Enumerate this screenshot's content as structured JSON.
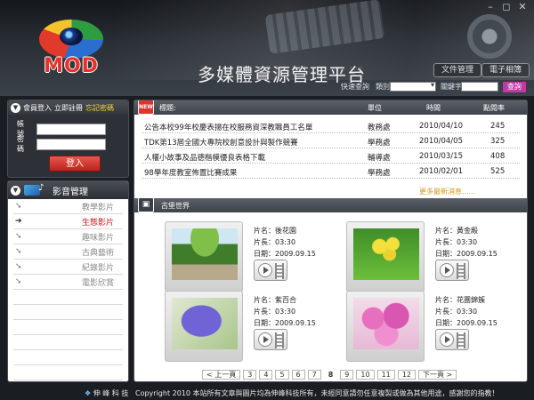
{
  "header": {
    "logo_text": "MOD",
    "title": "多媒體資源管理平台",
    "btn_file": "文件管理",
    "btn_album": "電子相簿",
    "window_controls": [
      "–",
      "◻",
      "✕"
    ]
  },
  "search": {
    "label": "快速查詢",
    "category_label": "類別",
    "category_value": "",
    "keyword_label": "關鍵字",
    "keyword_value": "",
    "button": "查詢"
  },
  "login": {
    "member_login": "會員登入",
    "register": "立即註冊",
    "forgot": "忘記密碼",
    "account_label": "帳　號",
    "password_label": "密　碼",
    "account_value": "",
    "password_value": "",
    "submit": "登入"
  },
  "menu": {
    "title": "影音管理",
    "items": [
      {
        "label": "教學影片"
      },
      {
        "label": "生態影片"
      },
      {
        "label": "趣味影片"
      },
      {
        "label": "古典藝術"
      },
      {
        "label": "紀錄影片"
      },
      {
        "label": "電影欣賞"
      }
    ]
  },
  "news": {
    "badge": "NEW",
    "columns": {
      "title": "標題:",
      "unit": "單位",
      "date": "時間",
      "clicks": "點閱率"
    },
    "rows": [
      {
        "title": "公告本校99年校慶表揚在校服務資深教職員工名單",
        "unit": "教務處",
        "date": "2010/04/10",
        "clicks": "245"
      },
      {
        "title": "TDK第13屆全國大專院校創意設計與製作競賽",
        "unit": "學務處",
        "date": "2010/04/05",
        "clicks": "325"
      },
      {
        "title": "人權小故事及品德楷模優良表格下載",
        "unit": "輔導處",
        "date": "2010/03/15",
        "clicks": "408"
      },
      {
        "title": "98學年度教室佈置比賽成果",
        "unit": "學務處",
        "date": "2010/02/01",
        "clicks": "525"
      }
    ],
    "more": "更多最新消息......"
  },
  "gallery": {
    "title": "古堡世界",
    "name_label": "片名：",
    "length_label": "片長：",
    "date_label": "日期：",
    "cards": [
      {
        "name": "後花園",
        "length": "03:30",
        "date": "2009.09.15"
      },
      {
        "name": "黃金殿",
        "length": "03:30",
        "date": "2009.09.15"
      },
      {
        "name": "紫百合",
        "length": "03:30",
        "date": "2009.09.15"
      },
      {
        "name": "花團錦簇",
        "length": "03:30",
        "date": "2009.09.15"
      }
    ]
  },
  "pager": {
    "prev": "< 上一頁",
    "pages": [
      "3",
      "4",
      "5",
      "6",
      "7",
      "8",
      "9",
      "10",
      "11",
      "12"
    ],
    "current": "8",
    "next": "下一頁 >"
  },
  "footer": {
    "brand": "伸 峰 科 技",
    "copyright": "Copyright 2010 本站所有文章與圖片均為伸峰科技所有，未經同意請勿任意複製或做為其他用途，感謝您的指教！"
  },
  "colors": {
    "accent_red": "#d0121b",
    "search_button": "#c03aa4",
    "more_link": "#d59a16"
  }
}
